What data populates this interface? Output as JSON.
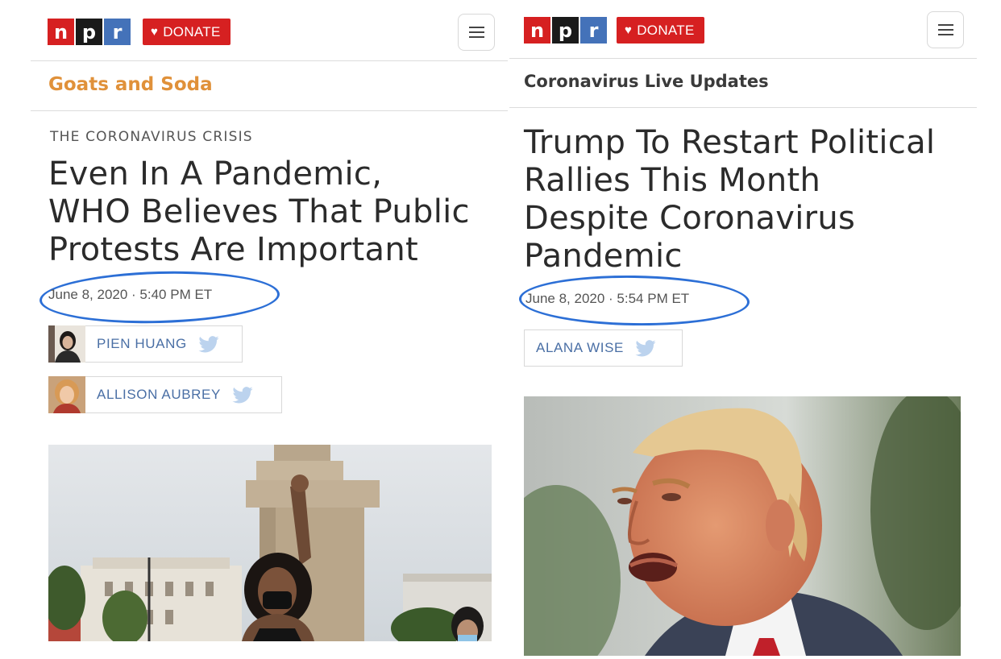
{
  "brand": {
    "letters": [
      "n",
      "p",
      "r"
    ],
    "logo_colors": [
      "#d62021",
      "#1a1a1a",
      "#4472b9"
    ]
  },
  "donate": {
    "label": "DONATE",
    "icon": "heart-icon"
  },
  "menu": {
    "icon": "hamburger-menu-icon"
  },
  "colors": {
    "accent_orange": "#e0913a",
    "circle_blue": "#2c6fd6",
    "donate_red": "#d62021",
    "author_blue": "#4a6fa5"
  },
  "left": {
    "section": "Goats and Soda",
    "eyebrow": "THE CORONAVIRUS CRISIS",
    "headline": [
      "Even In A Pandemic,",
      "WHO Believes That Public",
      "Protests Are Important"
    ],
    "date": "June 8, 2020 · 5:40 PM ET",
    "authors": [
      {
        "name": "PIEN HUANG"
      },
      {
        "name": "ALLISON AUBREY"
      }
    ]
  },
  "right": {
    "section": "Coronavirus Live Updates",
    "headline": [
      "Trump To Restart Political",
      "Rallies This Month",
      "Despite Coronavirus",
      "Pandemic"
    ],
    "date": "June 8, 2020 · 5:54 PM ET",
    "authors": [
      {
        "name": "ALANA WISE"
      }
    ]
  }
}
